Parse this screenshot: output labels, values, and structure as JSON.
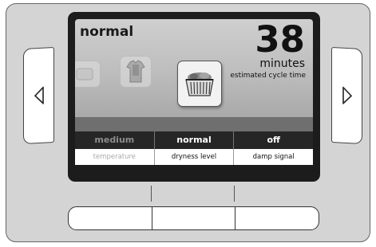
{
  "display": {
    "cycle_name": "normal",
    "time_value": "38",
    "time_units": "minutes",
    "time_caption": "estimated cycle time"
  },
  "options": [
    {
      "value": "medium",
      "label": "temperature",
      "active": false
    },
    {
      "value": "normal",
      "label": "dryness level",
      "active": true
    },
    {
      "value": "off",
      "label": "damp signal",
      "active": true
    }
  ],
  "icons": {
    "left_arrow": "left-arrow-icon",
    "right_arrow": "right-arrow-icon",
    "selected_cycle": "laundry-basket-icon",
    "adjacent_cycle_1": "cycle-icon",
    "adjacent_cycle_2": "shirt-icon"
  },
  "colors": {
    "panel": "#d4d4d4",
    "screen_bezel": "#1c1c1c",
    "options_bar": "#262626"
  }
}
